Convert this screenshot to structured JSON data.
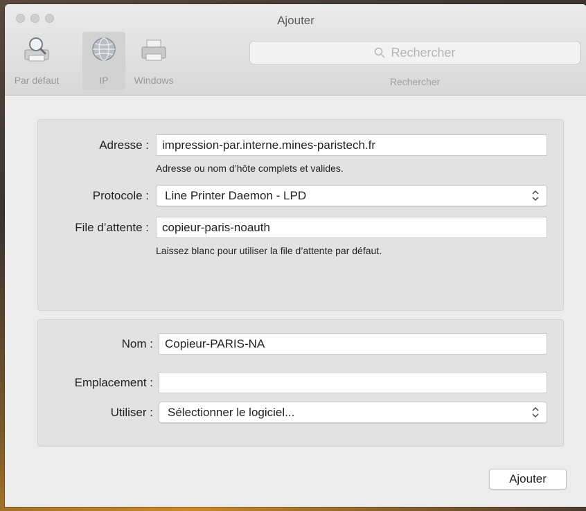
{
  "window": {
    "title": "Ajouter"
  },
  "toolbar": {
    "items": [
      {
        "label": "Par défaut",
        "icon": "default-printer-search-icon"
      },
      {
        "label": "IP",
        "icon": "globe-network-icon",
        "selected": true
      },
      {
        "label": "Windows",
        "icon": "windows-printer-icon"
      }
    ],
    "search": {
      "placeholder": "Rechercher",
      "caption": "Rechercher"
    }
  },
  "ip_panel": {
    "address_label": "Adresse :",
    "address_value": "impression-par.interne.mines-paristech.fr",
    "address_hint": "Adresse ou nom d’hôte complets et valides.",
    "protocol_label": "Protocole :",
    "protocol_value": "Line Printer Daemon - LPD",
    "queue_label": "File d’attente :",
    "queue_value": "copieur-paris-noauth",
    "queue_hint": "Laissez blanc pour utiliser la file d’attente par défaut."
  },
  "info_panel": {
    "name_label": "Nom :",
    "name_value": "Copieur-PARIS-NA",
    "location_label": "Emplacement :",
    "location_value": "",
    "use_label": "Utiliser :",
    "use_value": "Sélectionner le logiciel..."
  },
  "actions": {
    "add_label": "Ajouter"
  },
  "colors": {
    "window_bg": "#ececec",
    "panel_bg": "#e2e2e2",
    "label_gray": "#9a9a9a"
  }
}
